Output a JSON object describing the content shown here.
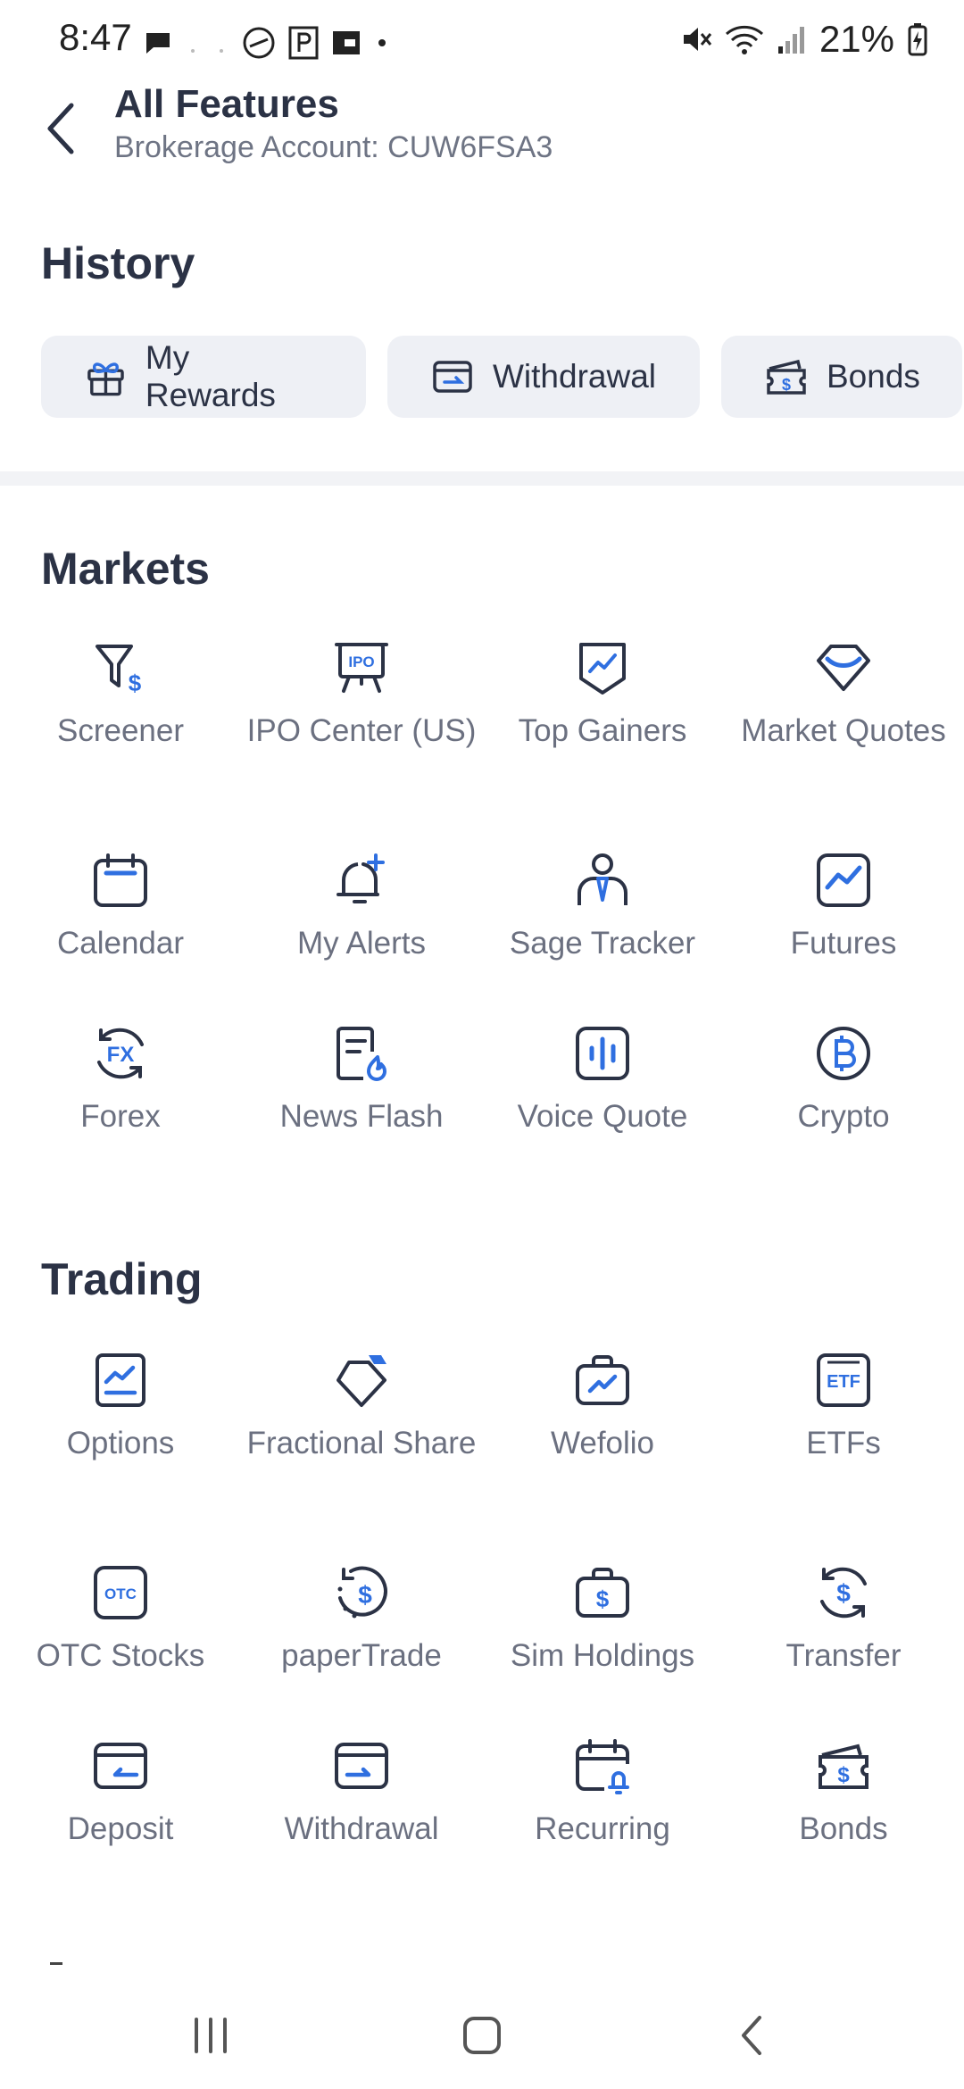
{
  "status_bar": {
    "time": "8:47",
    "battery": "21%"
  },
  "header": {
    "title": "All Features",
    "subtitle": "Brokerage Account: CUW6FSA3"
  },
  "history": {
    "title": "History",
    "chips": [
      {
        "label": "My Rewards",
        "icon": "gift-icon"
      },
      {
        "label": "Withdrawal",
        "icon": "card-withdraw-icon"
      },
      {
        "label": "Bonds",
        "icon": "bond-icon"
      }
    ]
  },
  "markets": {
    "title": "Markets",
    "items": [
      {
        "label": "Screener",
        "icon": "filter-dollar-icon"
      },
      {
        "label": "IPO Center (US)",
        "icon": "ipo-icon"
      },
      {
        "label": "Top Gainers",
        "icon": "top-gainers-icon"
      },
      {
        "label": "Market Quotes",
        "icon": "diamond-icon"
      },
      {
        "label": "Calendar",
        "icon": "calendar-icon"
      },
      {
        "label": "My Alerts",
        "icon": "bell-plus-icon"
      },
      {
        "label": "Sage Tracker",
        "icon": "person-tie-icon"
      },
      {
        "label": "Futures",
        "icon": "chart-square-icon"
      },
      {
        "label": "Forex",
        "icon": "fx-icon"
      },
      {
        "label": "News Flash",
        "icon": "news-fire-icon"
      },
      {
        "label": "Voice Quote",
        "icon": "voice-bars-icon"
      },
      {
        "label": "Crypto",
        "icon": "bitcoin-icon"
      }
    ]
  },
  "trading": {
    "title": "Trading",
    "items": [
      {
        "label": "Options",
        "icon": "options-icon"
      },
      {
        "label": "Fractional Share",
        "icon": "fractional-tag-icon"
      },
      {
        "label": "Wefolio",
        "icon": "briefcase-chart-icon"
      },
      {
        "label": "ETFs",
        "icon": "etf-icon"
      },
      {
        "label": "OTC Stocks",
        "icon": "otc-icon"
      },
      {
        "label": "paperTrade",
        "icon": "paper-dollar-icon"
      },
      {
        "label": "Sim Holdings",
        "icon": "bag-dollar-icon"
      },
      {
        "label": "Transfer",
        "icon": "transfer-dollar-icon"
      },
      {
        "label": "Deposit",
        "icon": "card-deposit-icon"
      },
      {
        "label": "Withdrawal",
        "icon": "card-withdraw-icon"
      },
      {
        "label": "Recurring",
        "icon": "calendar-bell-icon"
      },
      {
        "label": "Bonds",
        "icon": "bond-icon"
      }
    ]
  },
  "colors": {
    "text_dark": "#2b3245",
    "text_muted": "#6b7080",
    "accent_blue": "#2f6fe0",
    "chip_bg": "#eef0f5"
  }
}
